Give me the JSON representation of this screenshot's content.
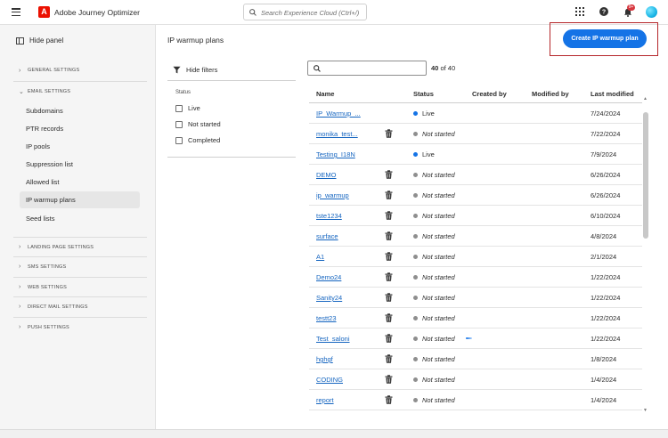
{
  "app": {
    "title": "Adobe Journey Optimizer",
    "logo_letter": "A"
  },
  "search": {
    "placeholder": "Search Experience Cloud (Ctrl+/)"
  },
  "topbar": {
    "notification_count": "9+"
  },
  "sidebar": {
    "hide_panel_label": "Hide panel",
    "sections": [
      {
        "label": "GENERAL SETTINGS",
        "expanded": false
      },
      {
        "label": "EMAIL SETTINGS",
        "expanded": true
      },
      {
        "label": "LANDING PAGE SETTINGS",
        "expanded": false
      },
      {
        "label": "SMS SETTINGS",
        "expanded": false
      },
      {
        "label": "WEB SETTINGS",
        "expanded": false
      },
      {
        "label": "DIRECT MAIL SETTINGS",
        "expanded": false
      },
      {
        "label": "PUSH SETTINGS",
        "expanded": false
      }
    ],
    "email_items": [
      "Subdomains",
      "PTR records",
      "IP pools",
      "Suppression list",
      "Allowed list",
      "IP warmup plans",
      "Seed lists"
    ],
    "active_item": "IP warmup plans"
  },
  "main": {
    "title": "IP warmup plans",
    "create_button": "Create IP warmup plan",
    "hide_filters": "Hide filters",
    "filter_group_label": "Status",
    "filter_options": [
      "Live",
      "Not started",
      "Completed"
    ],
    "count_current": "40",
    "count_text": "of 40"
  },
  "table": {
    "columns": [
      "Name",
      "Status",
      "Created by",
      "Modified by",
      "Last modified"
    ],
    "rows": [
      {
        "name": "IP_Warmup_...",
        "deletable": false,
        "status": "Live",
        "date": "7/24/2024"
      },
      {
        "name": "monika_test...",
        "deletable": true,
        "status": "Not started",
        "date": "7/22/2024"
      },
      {
        "name": "Testing_I18N",
        "deletable": false,
        "status": "Live",
        "date": "7/9/2024"
      },
      {
        "name": "DEMO",
        "deletable": true,
        "status": "Not started",
        "date": "6/26/2024"
      },
      {
        "name": "ip_warmup",
        "deletable": true,
        "status": "Not started",
        "date": "6/26/2024"
      },
      {
        "name": "tste1234",
        "deletable": true,
        "status": "Not started",
        "date": "6/10/2024"
      },
      {
        "name": "surface",
        "deletable": true,
        "status": "Not started",
        "date": "4/8/2024"
      },
      {
        "name": "A1",
        "deletable": true,
        "status": "Not started",
        "date": "2/1/2024"
      },
      {
        "name": "Demo24",
        "deletable": true,
        "status": "Not started",
        "date": "1/22/2024"
      },
      {
        "name": "Sanity24",
        "deletable": true,
        "status": "Not started",
        "date": "1/22/2024"
      },
      {
        "name": "testt23",
        "deletable": true,
        "status": "Not started",
        "date": "1/22/2024"
      },
      {
        "name": "Test_saloni",
        "deletable": true,
        "status": "Not started",
        "date": "1/22/2024",
        "loading": true
      },
      {
        "name": "hghgf",
        "deletable": true,
        "status": "Not started",
        "date": "1/8/2024"
      },
      {
        "name": "CODING",
        "deletable": true,
        "status": "Not started",
        "date": "1/4/2024"
      },
      {
        "name": "report",
        "deletable": true,
        "status": "Not started",
        "date": "1/4/2024"
      }
    ]
  },
  "colors": {
    "live": "#1473e6",
    "not_started": "#8e8e8e",
    "accent": "#1473e6",
    "highlight_outline": "#b5262a"
  }
}
